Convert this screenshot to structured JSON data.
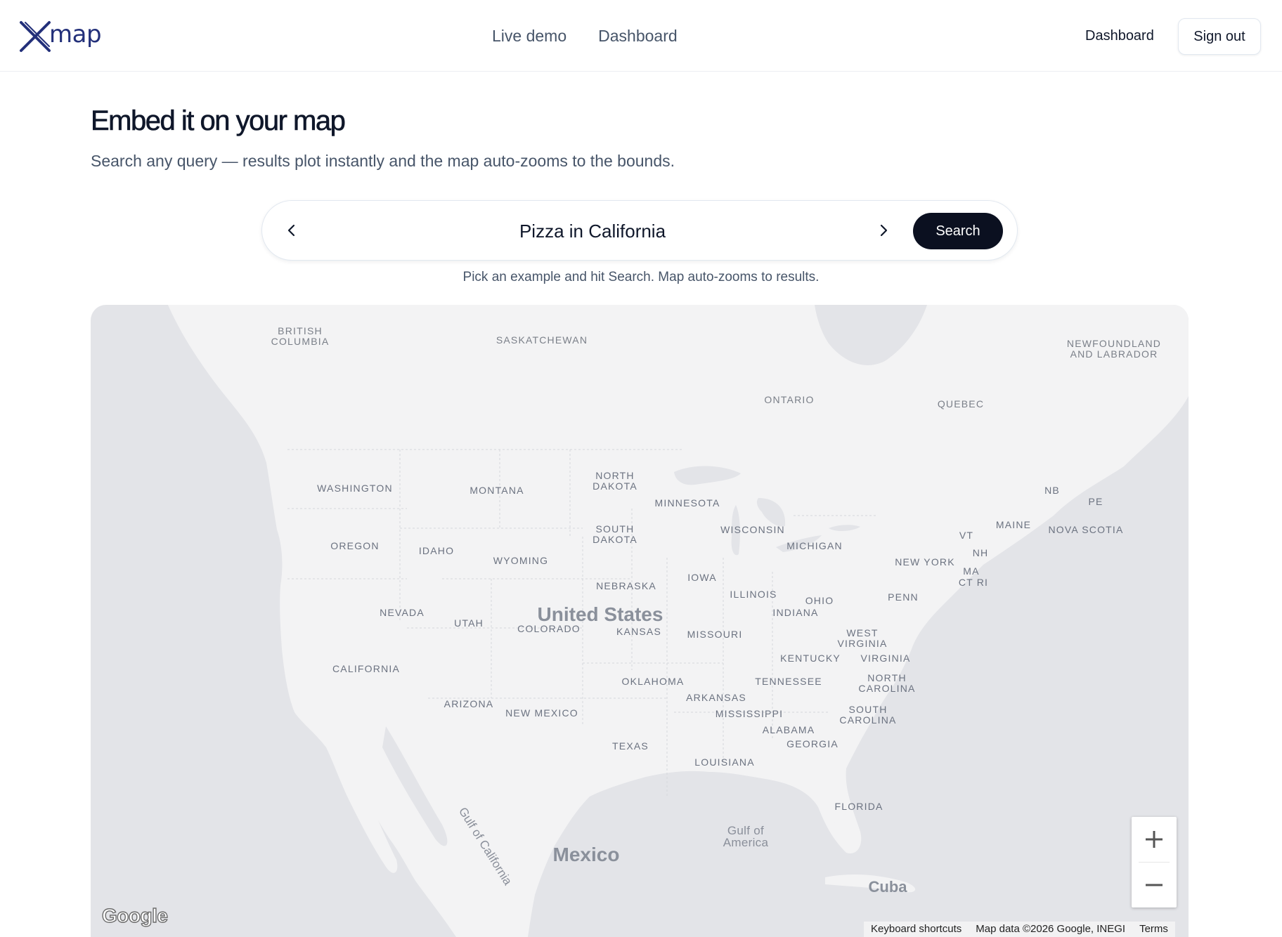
{
  "header": {
    "logo_text": "map",
    "nav": [
      {
        "label": "Live demo"
      },
      {
        "label": "Dashboard"
      }
    ],
    "right_link": "Dashboard",
    "sign_out": "Sign out",
    "brand_color": "#23307a"
  },
  "hero": {
    "title": "Embed it on your map",
    "subtitle": "Search any query — results plot instantly and the map auto-zooms to the bounds."
  },
  "search": {
    "query": "Pizza in California",
    "button_label": "Search",
    "hint": "Pick an example and hit Search. Map auto-zooms to results.",
    "button_color": "#0b1020"
  },
  "map": {
    "land_color": "#f3f3f4",
    "water_color": "#e3e4e8",
    "labels": {
      "british_columbia": "BRITISH\nCOLUMBIA",
      "saskatchewan": "SASKATCHEWAN",
      "newfoundland": "NEWFOUNDLAND\nAND LABRADOR",
      "ontario": "ONTARIO",
      "quebec": "QUEBEC",
      "washington": "WASHINGTON",
      "montana": "MONTANA",
      "north_dakota": "NORTH\nDAKOTA",
      "minnesota": "MINNESOTA",
      "nb": "NB",
      "pe": "PE",
      "south_dakota": "SOUTH\nDAKOTA",
      "wisconsin": "WISCONSIN",
      "maine": "MAINE",
      "nova_scotia": "NOVA SCOTIA",
      "vt": "VT",
      "oregon": "OREGON",
      "idaho": "IDAHO",
      "michigan": "MICHIGAN",
      "nh": "NH",
      "wyoming": "WYOMING",
      "new_york": "NEW YORK",
      "ma": "MA",
      "iowa": "IOWA",
      "ct_ri": "CT RI",
      "nebraska": "NEBRASKA",
      "illinois": "ILLINOIS",
      "penn": "PENN",
      "ohio": "OHIO",
      "nevada": "NEVADA",
      "united_states": "United States",
      "indiana": "INDIANA",
      "utah": "UTAH",
      "west_virginia": "WEST\nVIRGINIA",
      "colorado": "COLORADO",
      "kansas": "KANSAS",
      "missouri": "MISSOURI",
      "kentucky": "KENTUCKY",
      "virginia": "VIRGINIA",
      "california": "CALIFORNIA",
      "oklahoma": "OKLAHOMA",
      "tennessee": "TENNESSEE",
      "north_carolina": "NORTH\nCAROLINA",
      "arkansas": "ARKANSAS",
      "arizona": "ARIZONA",
      "new_mexico": "NEW MEXICO",
      "mississippi": "MISSISSIPPI",
      "south_carolina": "SOUTH\nCAROLINA",
      "alabama": "ALABAMA",
      "georgia": "GEORGIA",
      "texas": "TEXAS",
      "louisiana": "LOUISIANA",
      "florida": "FLORIDA",
      "gulf_of_california": "Gulf of California",
      "gulf_of_america": "Gulf of\nAmerica",
      "mexico": "Mexico",
      "cuba": "Cuba"
    },
    "zoom_in_icon": "plus-icon",
    "zoom_out_icon": "minus-icon",
    "google_logo": "Google",
    "attribution": {
      "shortcuts": "Keyboard shortcuts",
      "data": "Map data ©2026 Google, INEGI",
      "terms": "Terms"
    }
  }
}
